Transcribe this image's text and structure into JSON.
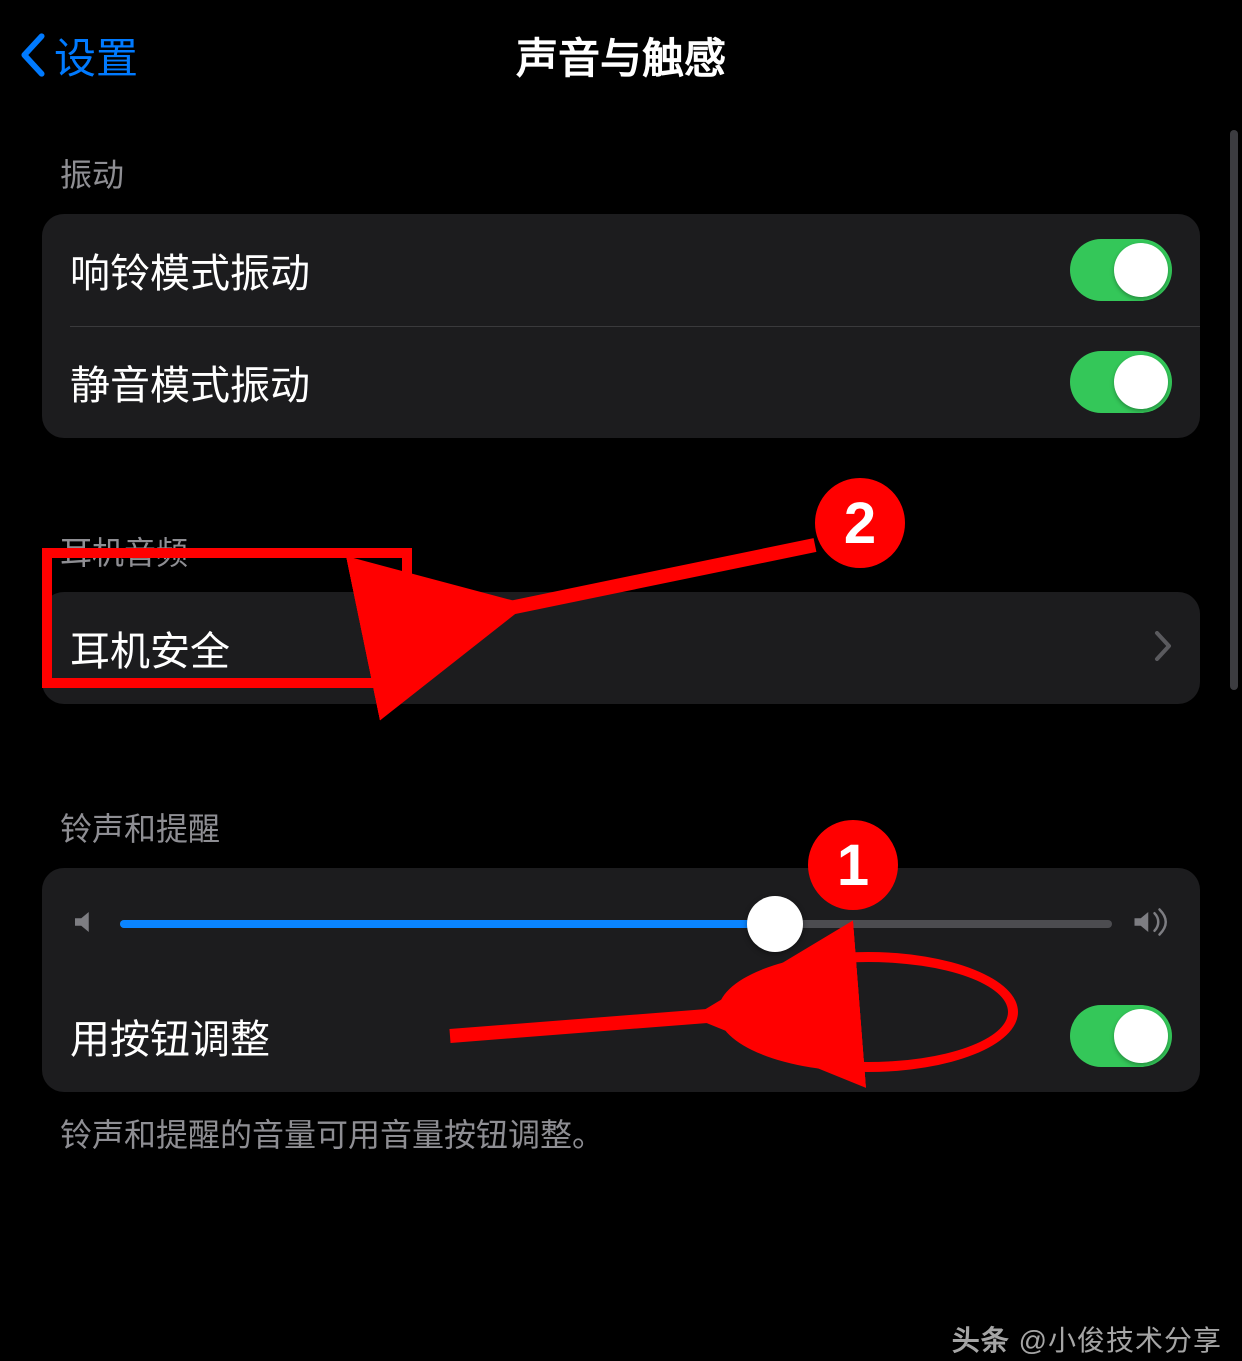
{
  "nav": {
    "back_label": "设置",
    "title": "声音与触感"
  },
  "sections": {
    "vibration": {
      "header": "振动",
      "ring_label": "响铃模式振动",
      "ring_on": true,
      "silent_label": "静音模式振动",
      "silent_on": true
    },
    "headphone": {
      "header": "耳机音频",
      "safety_label": "耳机安全"
    },
    "ringer": {
      "header": "铃声和提醒",
      "slider_percent": 66,
      "button_adjust_label": "用按钮调整",
      "button_adjust_on": true,
      "footer": "铃声和提醒的音量可用音量按钮调整。"
    }
  },
  "annotations": {
    "badge1": "1",
    "badge2": "2"
  },
  "watermark": {
    "prefix": "头条",
    "handle": "@小俊技术分享"
  }
}
